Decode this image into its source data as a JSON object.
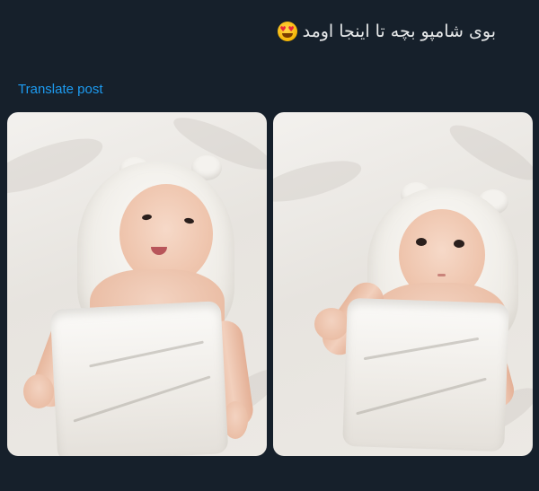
{
  "post": {
    "text": "بوی شامپو بچه تا اینجا اومد",
    "emoji": "heart-eyes-emoji"
  },
  "translate_label": "Translate post",
  "media": [
    {
      "name": "photo-1"
    },
    {
      "name": "photo-2"
    }
  ],
  "colors": {
    "background": "#16202b",
    "text": "#e7e9ea",
    "link": "#1d9bf0"
  }
}
